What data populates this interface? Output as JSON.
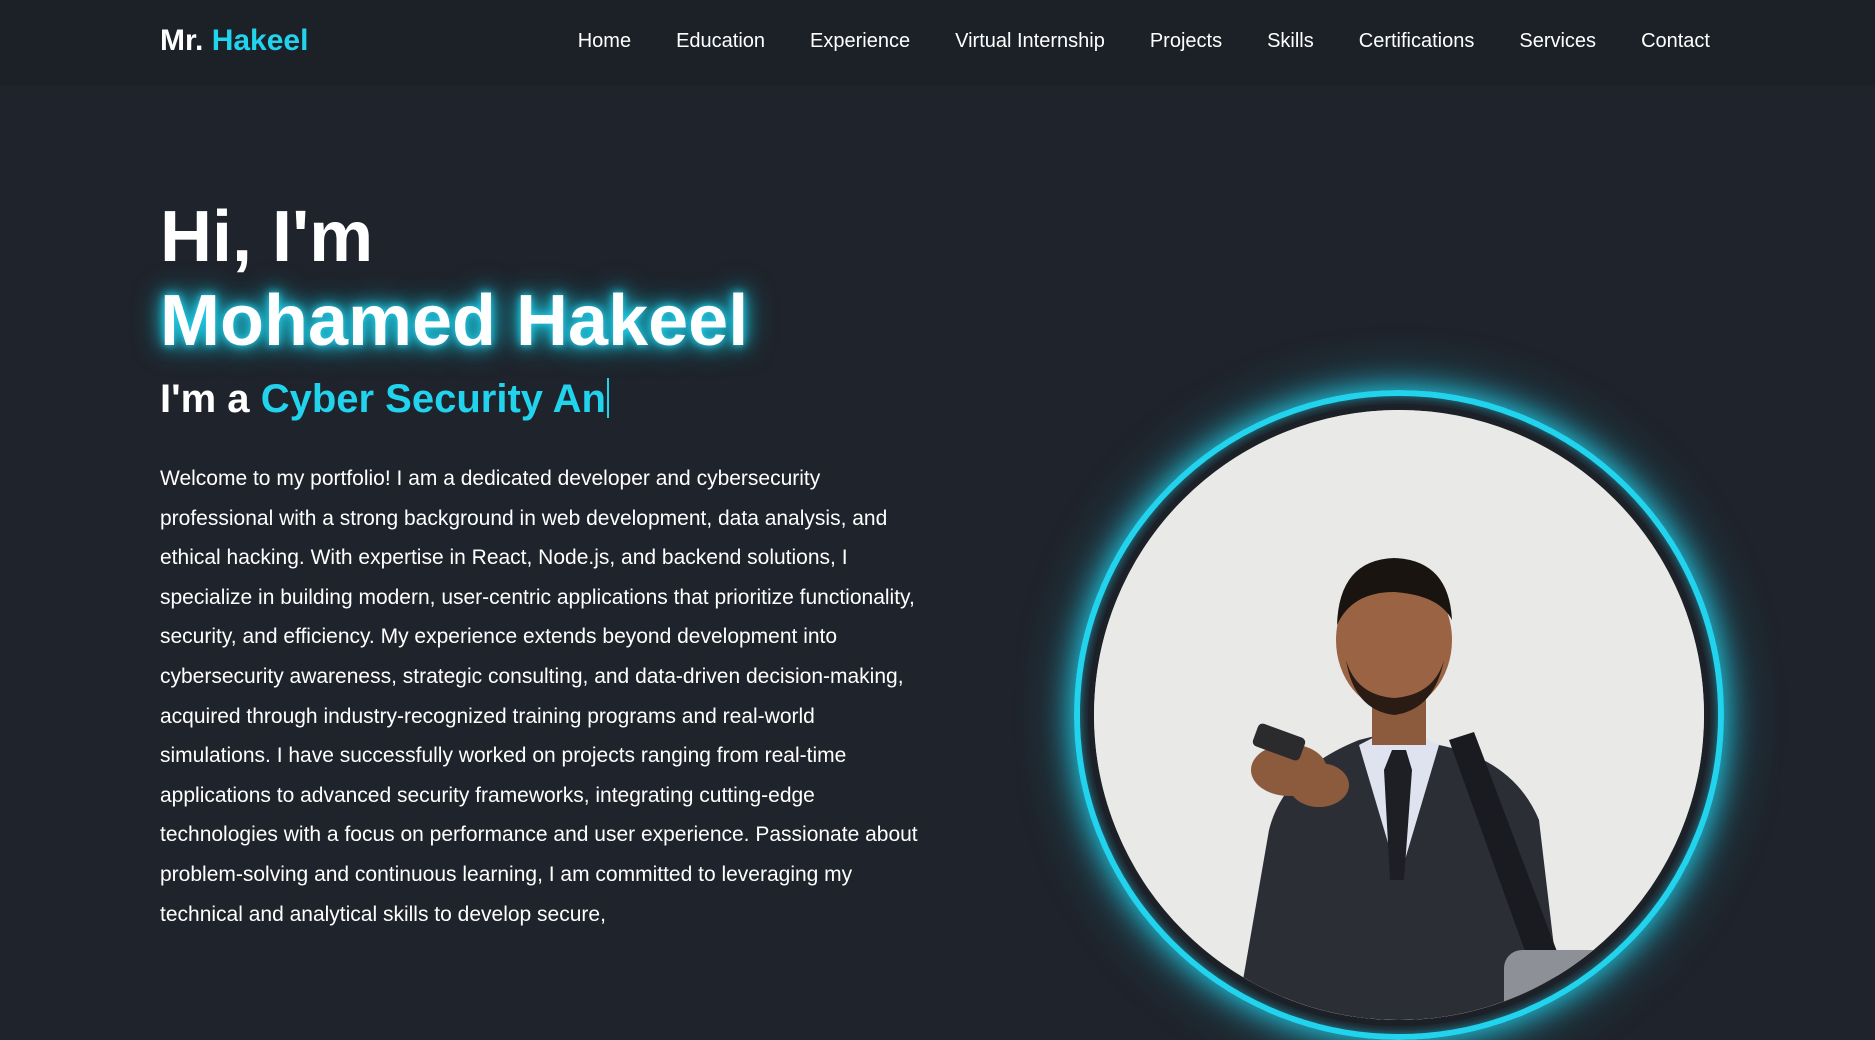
{
  "nav": {
    "logo_prefix": "Mr.",
    "logo_name": "Hakeel",
    "links": [
      "Home",
      "Education",
      "Experience",
      "Virtual Internship",
      "Projects",
      "Skills",
      "Certifications",
      "Services",
      "Contact"
    ]
  },
  "hero": {
    "greeting": "Hi, I'm",
    "name": "Mohamed Hakeel",
    "role_prefix": "I'm a",
    "role_typed": "Cyber Security An",
    "intro": "Welcome to my portfolio! I am a dedicated developer and cybersecurity professional with a strong background in web development, data analysis, and ethical hacking. With expertise in React, Node.js, and backend solutions, I specialize in building modern, user-centric applications that prioritize functionality, security, and efficiency. My experience extends beyond development into cybersecurity awareness, strategic consulting, and data-driven decision-making, acquired through industry-recognized training programs and real-world simulations. I have successfully worked on projects ranging from real-time applications to advanced security frameworks, integrating cutting-edge technologies with a focus on performance and user experience. Passionate about problem-solving and continuous learning, I am committed to leveraging my technical and analytical skills to develop secure,"
  },
  "colors": {
    "background": "#1f232b",
    "accent": "#22d3ee"
  },
  "avatar": {
    "icon": "profile-photo"
  }
}
